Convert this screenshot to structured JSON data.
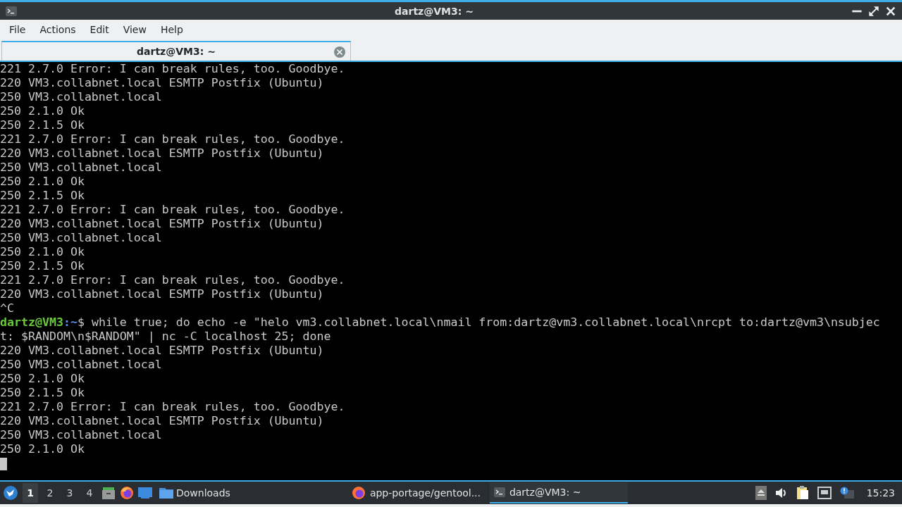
{
  "window": {
    "title": "dartz@VM3: ~"
  },
  "menu": [
    "File",
    "Actions",
    "Edit",
    "View",
    "Help"
  ],
  "tabs": [
    {
      "label": "dartz@VM3: ~",
      "selected": true
    }
  ],
  "terminal": {
    "lines": [
      {
        "kind": "output",
        "text": "221 2.7.0 Error: I can break rules, too. Goodbye."
      },
      {
        "kind": "output",
        "text": "220 VM3.collabnet.local ESMTP Postfix (Ubuntu)"
      },
      {
        "kind": "output",
        "text": "250 VM3.collabnet.local"
      },
      {
        "kind": "output",
        "text": "250 2.1.0 Ok"
      },
      {
        "kind": "output",
        "text": "250 2.1.5 Ok"
      },
      {
        "kind": "output",
        "text": "221 2.7.0 Error: I can break rules, too. Goodbye."
      },
      {
        "kind": "output",
        "text": "220 VM3.collabnet.local ESMTP Postfix (Ubuntu)"
      },
      {
        "kind": "output",
        "text": "250 VM3.collabnet.local"
      },
      {
        "kind": "output",
        "text": "250 2.1.0 Ok"
      },
      {
        "kind": "output",
        "text": "250 2.1.5 Ok"
      },
      {
        "kind": "output",
        "text": "221 2.7.0 Error: I can break rules, too. Goodbye."
      },
      {
        "kind": "output",
        "text": "220 VM3.collabnet.local ESMTP Postfix (Ubuntu)"
      },
      {
        "kind": "output",
        "text": "250 VM3.collabnet.local"
      },
      {
        "kind": "output",
        "text": "250 2.1.0 Ok"
      },
      {
        "kind": "output",
        "text": "250 2.1.5 Ok"
      },
      {
        "kind": "output",
        "text": "221 2.7.0 Error: I can break rules, too. Goodbye."
      },
      {
        "kind": "output",
        "text": "220 VM3.collabnet.local ESMTP Postfix (Ubuntu)"
      },
      {
        "kind": "output",
        "text": "^C"
      },
      {
        "kind": "prompt",
        "user_host": "dartz@VM3",
        "path": ":~",
        "symbol": "$",
        "text": " while true; do echo -e \"helo vm3.collabnet.local\\nmail from:dartz@vm3.collabnet.local\\nrcpt to:dartz@vm3\\nsubject: $RANDOM\\n$RANDOM\" | nc -C localhost 25; done"
      },
      {
        "kind": "output",
        "text": "220 VM3.collabnet.local ESMTP Postfix (Ubuntu)"
      },
      {
        "kind": "output",
        "text": "250 VM3.collabnet.local"
      },
      {
        "kind": "output",
        "text": "250 2.1.0 Ok"
      },
      {
        "kind": "output",
        "text": "250 2.1.5 Ok"
      },
      {
        "kind": "output",
        "text": "221 2.7.0 Error: I can break rules, too. Goodbye."
      },
      {
        "kind": "output",
        "text": "220 VM3.collabnet.local ESMTP Postfix (Ubuntu)"
      },
      {
        "kind": "output",
        "text": "250 VM3.collabnet.local"
      },
      {
        "kind": "output",
        "text": "250 2.1.0 Ok"
      }
    ]
  },
  "taskbar": {
    "desktops": [
      {
        "label": "1",
        "selected": true
      },
      {
        "label": "2",
        "selected": false
      },
      {
        "label": "3",
        "selected": false
      },
      {
        "label": "4",
        "selected": false
      }
    ],
    "folder": "Downloads",
    "tasks": [
      {
        "kind": "browser",
        "label": "app-portage/gentool...",
        "selected": false
      },
      {
        "kind": "terminal",
        "label": "dartz@VM3: ~",
        "selected": true
      }
    ],
    "clock": "15:23"
  }
}
